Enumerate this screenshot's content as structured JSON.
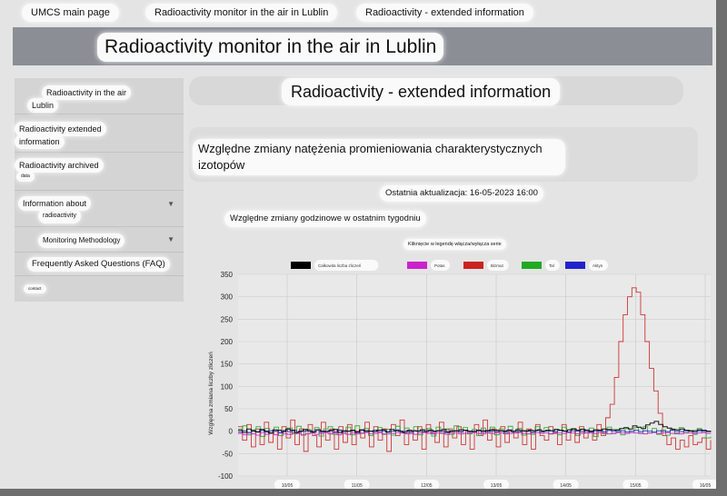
{
  "breadcrumbs": [
    "UMCS main page",
    "Radioactivity monitor in the air in Lublin",
    "Radioactivity - extended information"
  ],
  "header": {
    "title": "Radioactivity monitor in the air in Lublin"
  },
  "sidebar": {
    "items": [
      {
        "label_line1": "Radioactivity in the air",
        "label_line2": "Lublin"
      },
      {
        "label_line1": "Radioactivity extended",
        "label_line2": "information"
      },
      {
        "label_line1": "Radioactivity archived",
        "label_line2": "data"
      },
      {
        "label_line1": "Information about",
        "label_line2": "radioactivity"
      },
      {
        "label_line1": "Monitoring Methodology"
      },
      {
        "label_line1": "Frequently Asked Questions (FAQ)"
      },
      {
        "label_line1": "contact"
      }
    ]
  },
  "main": {
    "title": "Radioactivity - extended information",
    "subtitle": "Względne zmiany natężenia promieniowania charakterystycznych izotopów",
    "updated": "Ostatnia aktualizacja: 16-05-2023 16:00",
    "weekly": "Względne zmiany godzinowe w ostatnim tygodniu",
    "legend_hint": "Kliknięcie w legendę włącza/wyłącza serie"
  },
  "colors": {
    "total": "#000000",
    "lead": "#cc22cc",
    "bismuth": "#cc2222",
    "thorium": "#22aa22",
    "potassium": "#2222cc"
  },
  "chart_data": {
    "type": "line",
    "title": "Względne zmiany godzinowe w ostatnim tygodniu",
    "ylabel": "Względna zmiana liczby zliczeń",
    "ylim": [
      -100,
      350
    ],
    "yticks": [
      -100,
      -50,
      0,
      50,
      100,
      150,
      200,
      250,
      300,
      350
    ],
    "xticks": [
      "10/05",
      "11/05",
      "12/05",
      "13/05",
      "14/05",
      "15/05",
      "16/05"
    ],
    "series": [
      {
        "name": "Całkowita liczba zliczeń",
        "color": "#000000",
        "values": [
          2,
          -3,
          5,
          1,
          -2,
          4,
          0,
          -4,
          3,
          2,
          -1,
          5,
          2,
          -3,
          0,
          4,
          1,
          -2,
          3,
          0,
          -1,
          2,
          4,
          -3,
          1,
          0,
          2,
          -2,
          3,
          1,
          0,
          -1,
          2,
          3,
          -2,
          4,
          1,
          0,
          -3,
          2,
          1,
          0,
          3,
          -1,
          2,
          0,
          1,
          4,
          -2,
          0,
          1,
          3,
          2,
          0,
          -1,
          2,
          1,
          0,
          3,
          2,
          1,
          0,
          2,
          -1,
          3,
          1,
          0,
          2,
          1,
          3,
          0,
          2,
          1,
          4,
          2,
          0,
          3,
          5,
          2,
          4,
          1,
          0,
          3,
          2,
          5,
          4,
          3,
          2,
          6,
          8,
          5,
          12,
          9,
          6,
          14,
          18,
          22,
          15,
          10,
          7,
          4,
          3,
          5,
          2,
          0,
          1,
          3,
          2,
          0,
          1
        ]
      },
      {
        "name": "Potas",
        "color": "#cc22cc",
        "values": [
          -5,
          -8,
          -4,
          -6,
          -9,
          -3,
          -7,
          -5,
          -8,
          -4,
          -6,
          -7,
          -3,
          -5,
          -8,
          -6,
          -4,
          -7,
          -5,
          -3,
          -6,
          -4,
          -8,
          -5,
          -7,
          -4,
          -6,
          -5,
          -3,
          -6,
          -5,
          -4,
          -7,
          -6,
          -5,
          -3,
          -4,
          -6,
          -5,
          -7,
          -4,
          -3,
          -5,
          -6,
          -4,
          -5,
          -7,
          -3,
          -4,
          -6,
          -5,
          -4,
          -3,
          -5,
          -6,
          -4,
          -5,
          -3,
          -4,
          -6,
          -5,
          -4,
          -3,
          -5,
          -6,
          -4,
          -3,
          -5,
          -4,
          -6,
          -3,
          -4,
          -5,
          -3,
          -4,
          -6,
          -5,
          -3,
          -4,
          -5,
          -3,
          -4,
          -6,
          -5,
          -3,
          -4,
          -5,
          -3,
          -4,
          -5,
          -6,
          -4,
          -3,
          -5,
          -4,
          -3,
          -5,
          -4,
          -6,
          -3,
          -4,
          -5,
          -4,
          -3,
          -5,
          -4
        ]
      },
      {
        "name": "Bizmut",
        "color": "#cc2222",
        "values": [
          10,
          -20,
          15,
          -35,
          5,
          -30,
          20,
          -25,
          0,
          -40,
          10,
          -15,
          25,
          -30,
          5,
          -45,
          15,
          -10,
          -35,
          20,
          -20,
          5,
          -40,
          10,
          -25,
          15,
          -30,
          0,
          -15,
          20,
          -35,
          10,
          -20,
          5,
          -45,
          15,
          -10,
          25,
          -30,
          0,
          -20,
          10,
          -40,
          15,
          -5,
          -25,
          20,
          -35,
          5,
          -15,
          10,
          -30,
          0,
          -40,
          15,
          -10,
          25,
          -20,
          5,
          -35,
          10,
          -25,
          0,
          -15,
          20,
          -30,
          5,
          -40,
          15,
          -10,
          -20,
          10,
          -5,
          -30,
          15,
          -20,
          5,
          -25,
          10,
          -15,
          0,
          -20,
          15,
          -10,
          30,
          60,
          120,
          200,
          260,
          300,
          320,
          310,
          260,
          200,
          140,
          90,
          40,
          -10,
          -30,
          -15,
          -40,
          -20,
          -35,
          -10,
          -30,
          -25,
          -15,
          -40,
          -20
        ]
      },
      {
        "name": "Tal",
        "color": "#22aa22",
        "values": [
          5,
          12,
          -8,
          3,
          10,
          -12,
          6,
          -4,
          9,
          -10,
          2,
          7,
          -6,
          11,
          -9,
          4,
          -3,
          8,
          -11,
          5,
          10,
          -7,
          3,
          -5,
          9,
          -8,
          12,
          -4,
          6,
          -10,
          2,
          8,
          -6,
          4,
          -9,
          11,
          -3,
          7,
          -5,
          10,
          -8,
          3,
          6,
          -11,
          9,
          -4,
          5,
          -7,
          12,
          -2,
          8,
          -6,
          4,
          -10,
          7,
          -3,
          9,
          -8,
          5,
          -5,
          11,
          -4,
          6,
          -9,
          3,
          -7,
          10,
          -2,
          8,
          -6,
          4,
          -8,
          9,
          -3,
          6,
          -10,
          5,
          -4,
          7,
          -12,
          3,
          -6,
          9,
          -5,
          4,
          -8,
          6,
          -3,
          8,
          -5,
          10,
          -4,
          6,
          -7,
          3,
          -9,
          5,
          -6,
          8,
          -4,
          2,
          -7,
          6,
          -3,
          -15,
          -12
        ]
      },
      {
        "name": "Aktyn",
        "color": "#2222cc",
        "values": [
          -2,
          1,
          -3,
          0,
          -1,
          2,
          -2,
          1,
          0,
          -3,
          1,
          -1,
          2,
          -2,
          0,
          1,
          -1,
          3,
          -2,
          0,
          1,
          -2,
          2,
          -1,
          0,
          1,
          -3,
          2,
          -1,
          0,
          2,
          -1,
          1,
          -2,
          0,
          3,
          -1,
          0,
          -2,
          1,
          0,
          -1,
          2,
          -2,
          1,
          0,
          -3,
          1,
          0,
          -1,
          2,
          -1,
          0,
          1,
          -2,
          2,
          0,
          -1,
          1,
          -2,
          3,
          0,
          -1,
          1,
          0,
          -2,
          2,
          -1,
          0,
          1,
          -1,
          2,
          0,
          -2,
          1,
          0,
          -1,
          3,
          -2,
          1,
          0,
          -1,
          2,
          0,
          -1,
          1,
          -2,
          0,
          2,
          -1,
          1,
          0,
          -2,
          1,
          0,
          -1,
          2,
          0,
          -1,
          1,
          0,
          -2,
          1,
          0,
          -1,
          0
        ]
      }
    ]
  }
}
